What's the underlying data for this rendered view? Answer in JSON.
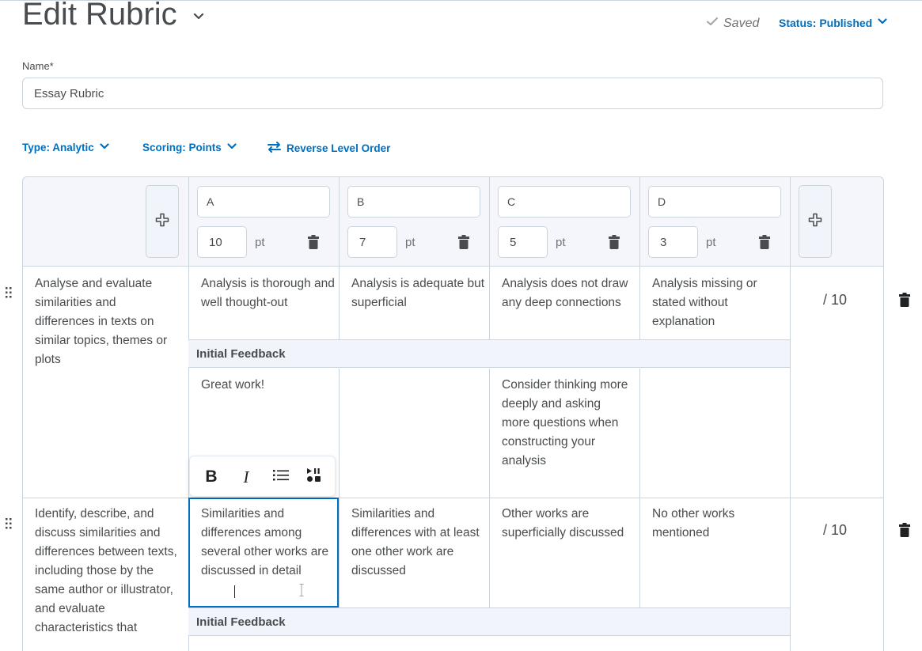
{
  "header": {
    "title": "Edit Rubric",
    "saved": "Saved",
    "status": "Status: Published"
  },
  "name": {
    "label": "Name*",
    "value": "Essay Rubric"
  },
  "options": {
    "type": "Type: Analytic",
    "scoring": "Scoring: Points",
    "reverse": "Reverse Level Order"
  },
  "levels": [
    {
      "name": "A",
      "points": "10",
      "unit": "pt"
    },
    {
      "name": "B",
      "points": "7",
      "unit": "pt"
    },
    {
      "name": "C",
      "points": "5",
      "unit": "pt"
    },
    {
      "name": "D",
      "points": "3",
      "unit": "pt"
    }
  ],
  "criteria": [
    {
      "name": "Analyse and evaluate similarities and differences in texts on similar topics, themes or plots",
      "descriptions": [
        "Analysis is thorough and well thought-out",
        "Analysis is adequate but superficial",
        "Analysis does not draw any deep connections",
        "Analysis missing or stated without explanation"
      ],
      "feedback_label": "Initial Feedback",
      "feedback": [
        "Great work!",
        "",
        "Consider thinking more deeply and asking more questions when constructing your analysis",
        ""
      ],
      "score": "/ 10"
    },
    {
      "name": "Identify, describe, and discuss similarities and differences between texts, including those by the same author or illustrator, and evaluate characteristics that",
      "descriptions": [
        "Similarities and differences among several other works are discussed in detail",
        "Similarities and differences with at least one other work are discussed",
        "Other works are superficially discussed",
        "No other works mentioned"
      ],
      "feedback_label": "Initial Feedback",
      "score": "/ 10"
    }
  ],
  "toolbar": {
    "bold": "B",
    "italic": "I"
  },
  "colors": {
    "accent": "#006fbf",
    "border": "#cdd5dc",
    "header_bg": "#f4f6fb",
    "text": "#494c4e"
  }
}
